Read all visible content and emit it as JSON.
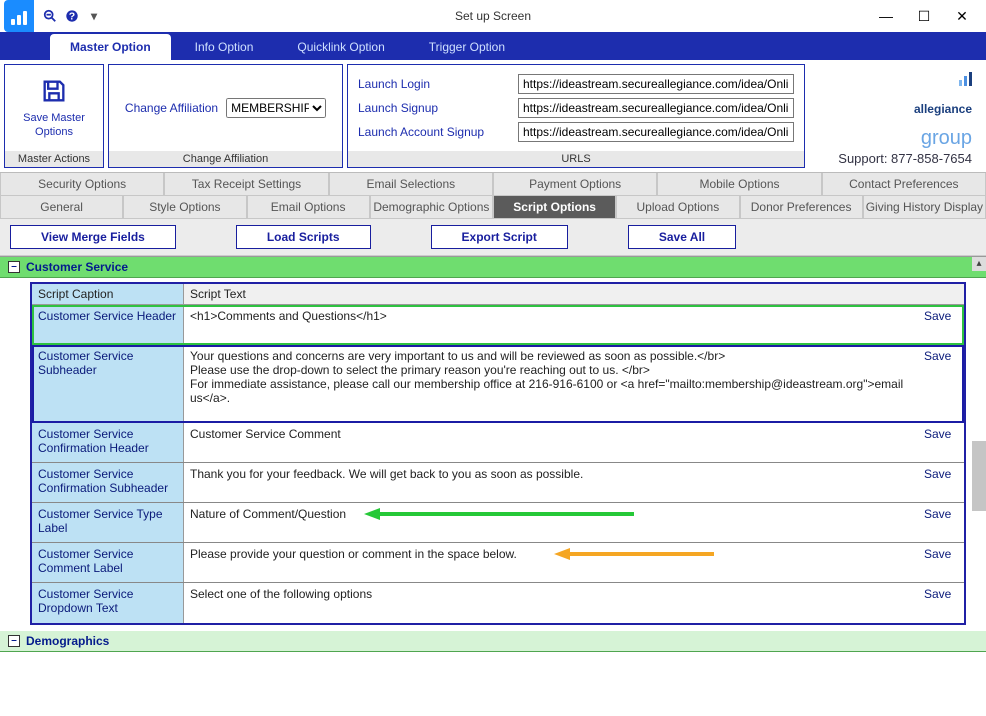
{
  "window": {
    "title": "Set up Screen"
  },
  "tabs": {
    "t0": "Master Option",
    "t1": "Info Option",
    "t2": "Quicklink Option",
    "t3": "Trigger Option"
  },
  "ribbon": {
    "save_master": "Save Master Options",
    "master_actions": "Master Actions",
    "change_affiliation_label": "Change Affiliation",
    "affiliation_value": "MEMBERSHIP",
    "change_affiliation_caption": "Change Affiliation",
    "launch_login_label": "Launch Login",
    "launch_login_url": "https://ideastream.secureallegiance.com/idea/OnlineDo",
    "launch_signup_label": "Launch Signup",
    "launch_signup_url": "https://ideastream.secureallegiance.com/idea/OnlineDo",
    "launch_acct_label": "Launch Account Signup",
    "launch_acct_url": "https://ideastream.secureallegiance.com/idea/OnlineDo",
    "urls_caption": "URLS",
    "brand1": "allegiance",
    "brand2": "group",
    "support": "Support: 877-858-7654"
  },
  "subtabs1": [
    "Security Options",
    "Tax Receipt Settings",
    "Email Selections",
    "Payment Options",
    "Mobile Options",
    "Contact Preferences"
  ],
  "subtabs2": [
    "General",
    "Style Options",
    "Email Options",
    "Demographic Options",
    "Script Options",
    "Upload Options",
    "Donor Preferences",
    "Giving History Display"
  ],
  "actions": {
    "merge": "View Merge Fields",
    "load": "Load Scripts",
    "export": "Export Script",
    "saveall": "Save All"
  },
  "section": {
    "cs": "Customer Service",
    "demo": "Demographics"
  },
  "gridhead": {
    "c": "Script Caption",
    "t": "Script Text"
  },
  "rows": [
    {
      "caption": "Customer Service Header",
      "text": "<h1>Comments and Questions</h1>",
      "save": "Save"
    },
    {
      "caption": "Customer Service Subheader",
      "text": "Your questions and concerns are very important to us and will be reviewed as soon as possible.</br>\nPlease use the drop-down to select the primary reason you're reaching out to us. </br>\nFor immediate assistance, please call our membership office at 216-916-6100 or <a href=\"mailto:membership@ideastream.org\">email us</a>.",
      "save": "Save"
    },
    {
      "caption": "Customer Service Confirmation Header",
      "text": "Customer Service Comment",
      "save": "Save"
    },
    {
      "caption": "Customer Service Confirmation Subheader",
      "text": "Thank you for your feedback. We will get back to you as soon as possible.",
      "save": "Save"
    },
    {
      "caption": "Customer Service Type Label",
      "text": "Nature of Comment/Question",
      "save": "Save"
    },
    {
      "caption": "Customer Service Comment Label",
      "text": "Please provide your question or comment in the space below.",
      "save": "Save"
    },
    {
      "caption": "Customer Service Dropdown Text",
      "text": "Select one of the following options",
      "save": "Save"
    }
  ]
}
